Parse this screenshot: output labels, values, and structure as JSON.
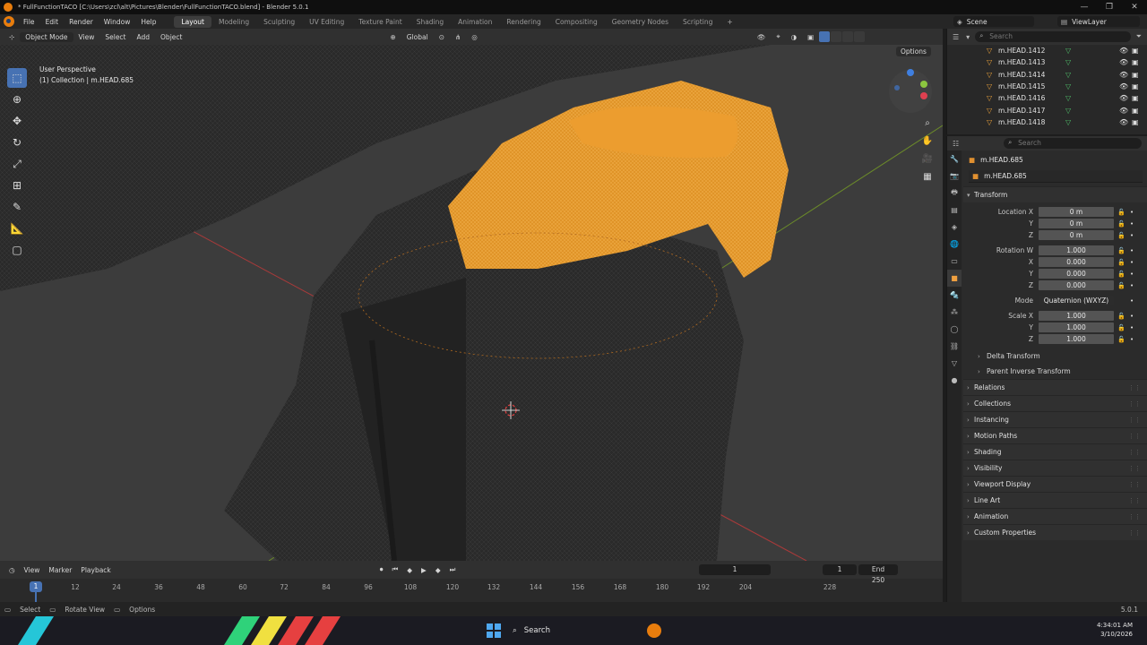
{
  "window": {
    "title": "* FullFunctionTACO [C:\\Users\\zcl\\alt\\Pictures\\Blender\\FullFunctionTACO.blend] - Blender 5.0.1",
    "controls": [
      "—",
      "❐",
      "✕"
    ]
  },
  "menubar": {
    "items": [
      "File",
      "Edit",
      "Render",
      "Window",
      "Help"
    ],
    "workspaces": [
      "Layout",
      "Modeling",
      "Sculpting",
      "UV Editing",
      "Texture Paint",
      "Shading",
      "Animation",
      "Rendering",
      "Compositing",
      "Geometry Nodes",
      "Scripting"
    ],
    "active_workspace": "Layout",
    "add_workspace": "+",
    "scene": "Scene",
    "view_layer": "ViewLayer"
  },
  "viewport_header": {
    "mode": "Object Mode",
    "menus": [
      "View",
      "Select",
      "Add",
      "Object"
    ],
    "orientation": "Global",
    "options": "Options"
  },
  "viewport": {
    "perspective": "User Perspective",
    "collection_line": "(1) Collection | m.HEAD.685"
  },
  "timeline": {
    "menus": [
      "View",
      "Marker",
      "Playback"
    ],
    "current_frame": "1",
    "start_frame": "1",
    "end_label": "End",
    "end_frame": "250",
    "ticks": [
      "12",
      "24",
      "36",
      "48",
      "60",
      "72",
      "84",
      "96",
      "108",
      "120",
      "132",
      "144",
      "156",
      "168",
      "180",
      "192",
      "204",
      "228"
    ],
    "playhead": "1"
  },
  "statusbar": {
    "items": [
      "Select",
      "Rotate View",
      "Options"
    ],
    "version": "5.0.1"
  },
  "outliner": {
    "search_placeholder": "Search",
    "rows": [
      "m.HEAD.1412",
      "m.HEAD.1413",
      "m.HEAD.1414",
      "m.HEAD.1415",
      "m.HEAD.1416",
      "m.HEAD.1417",
      "m.HEAD.1418"
    ]
  },
  "properties": {
    "search_placeholder": "Search",
    "object_name": "m.HEAD.685",
    "object_field": "m.HEAD.685",
    "transform": {
      "header": "Transform",
      "location_label": "Location X",
      "location": [
        "0 m",
        "0 m",
        "0 m"
      ],
      "rotation_label": "Rotation W",
      "rotation": [
        "1.000",
        "0.000",
        "0.000",
        "0.000"
      ],
      "mode_label": "Mode",
      "mode": "Quaternion (WXYZ)",
      "scale_label": "Scale X",
      "scale": [
        "1.000",
        "1.000",
        "1.000"
      ],
      "axis_y": "Y",
      "axis_z": "Z",
      "axis_x": "X"
    },
    "subpanels": [
      "Delta Transform",
      "Parent Inverse Transform"
    ],
    "panels": [
      "Relations",
      "Collections",
      "Instancing",
      "Motion Paths",
      "Shading",
      "Visibility",
      "Viewport Display",
      "Line Art",
      "Animation",
      "Custom Properties"
    ]
  },
  "taskbar": {
    "search": "Search",
    "time": "4:34:01 AM",
    "date": "3/10/2026"
  },
  "colors": {
    "accent": "#4772b3",
    "selection_orange": "#e59a2e",
    "mesh_dark": "#252525"
  }
}
